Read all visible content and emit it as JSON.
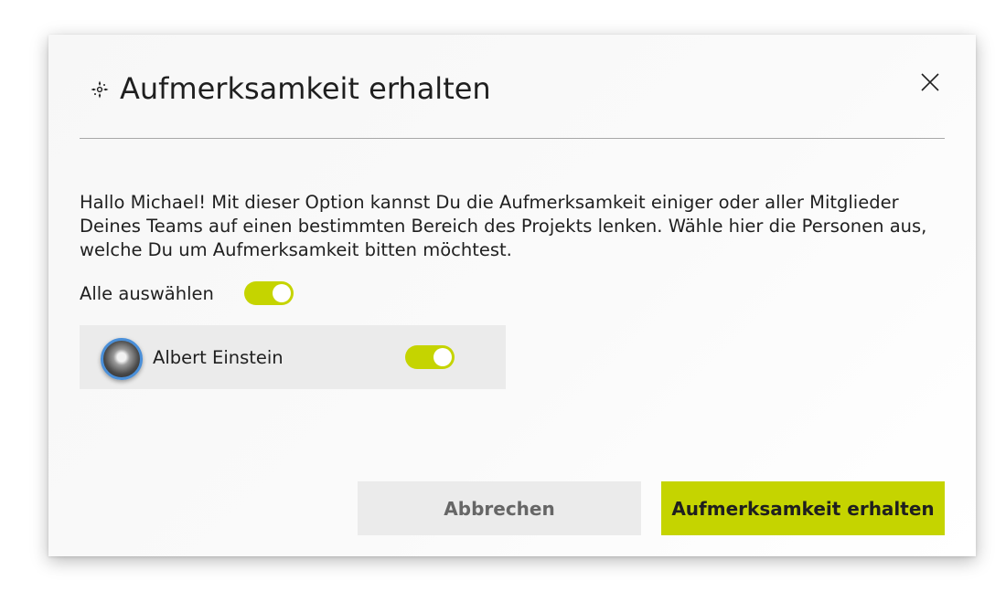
{
  "dialog": {
    "title": "Aufmerksamkeit erhalten",
    "header_icon": "attention-focus-icon",
    "close_icon": "close-icon",
    "description": "Hallo Michael! Mit dieser Option kannst Du die Aufmerksamkeit einiger oder aller Mitglieder Deines Teams auf einen bestimmten Bereich des Projekts lenken. Wähle hier die Personen aus, welche Du um Aufmerksamkeit bitten möchtest.",
    "select_all": {
      "label": "Alle auswählen",
      "enabled": true
    },
    "members": [
      {
        "name": "Albert Einstein",
        "avatar": "avatar-photo",
        "selected": true
      }
    ],
    "buttons": {
      "cancel_label": "Abbrechen",
      "confirm_label": "Aufmerksamkeit erhalten"
    }
  },
  "colors": {
    "accent": "#c5d400",
    "avatar_border": "#4a8fd8",
    "button_secondary_bg": "#ebebeb",
    "member_row_bg": "#ebebeb"
  }
}
